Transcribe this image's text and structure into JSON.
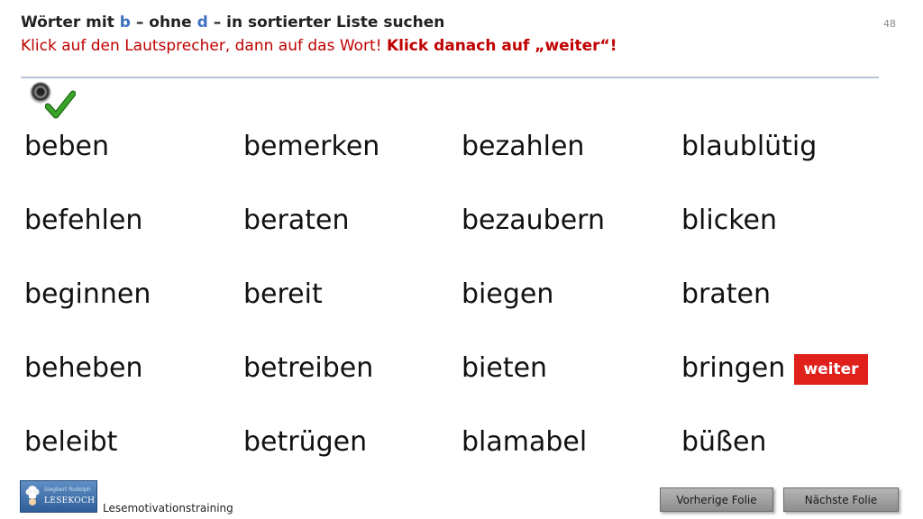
{
  "header": {
    "title_prefix": "Wörter mit ",
    "title_b": "b",
    "title_mid": " – ohne ",
    "title_d": "d",
    "title_suffix": " – in sortierter Liste suchen",
    "instruction": "Klick auf den Lautsprecher, dann auf das Wort! ",
    "instruction_bold": "Klick danach auf „weiter“!",
    "page_number": "48"
  },
  "words": {
    "col1": [
      "beben",
      "befehlen",
      "beginnen",
      "beheben",
      "beleibt"
    ],
    "col2": [
      "bemerken",
      "beraten",
      "bereit",
      "betreiben",
      "betrügen"
    ],
    "col3": [
      "bezahlen",
      "bezaubern",
      "biegen",
      "bieten",
      "blamabel"
    ],
    "col4": [
      "blaublütig",
      "blicken",
      "braten",
      "bringen",
      "büßen"
    ]
  },
  "weiter_label": "weiter",
  "logo": {
    "small": "Siegbert Rudolph",
    "main": "LESEKOCH"
  },
  "footer": {
    "label": "Lesemotivationstraining"
  },
  "nav": {
    "prev_label": "Vorherige  Folie",
    "next_label": "Nächste  Folie"
  },
  "colors": {
    "accent_blue": "#3d70c0",
    "instruction_red": "#c00000",
    "weiter_red": "#e0201b",
    "check_green": "#3aa32a"
  }
}
